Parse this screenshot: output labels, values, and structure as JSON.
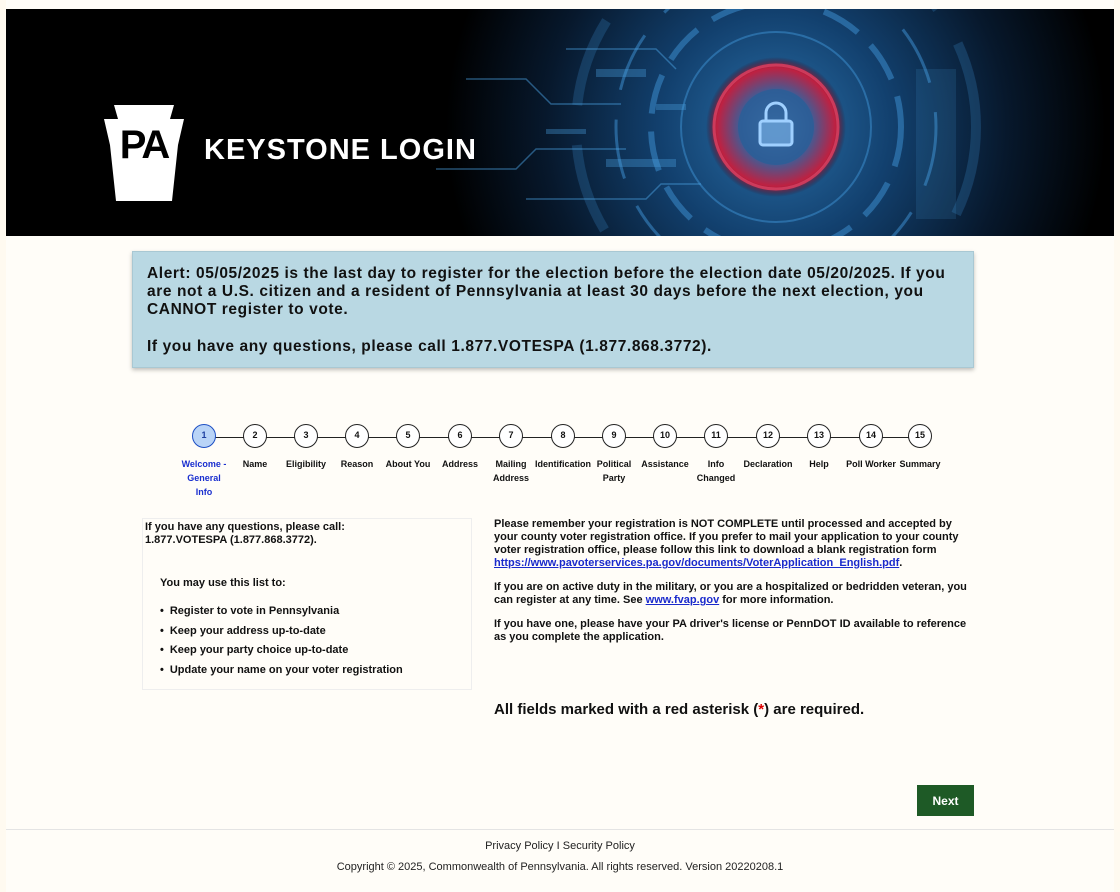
{
  "banner": {
    "logo_letters": "PA",
    "title": "KEYSTONE LOGIN"
  },
  "alert": {
    "message": "Alert: 05/05/2025 is the last day to register for the election before the election date 05/20/2025. If you are not a U.S. citizen and a resident of Pennsylvania at least 30 days before the next election, you CANNOT register to vote.",
    "questions": "If you have any questions, please call 1.877.VOTESPA (1.877.868.3772)."
  },
  "stepper": {
    "steps": [
      {
        "number": "1",
        "label": "Welcome - General Info"
      },
      {
        "number": "2",
        "label": "Name"
      },
      {
        "number": "3",
        "label": "Eligibility"
      },
      {
        "number": "4",
        "label": "Reason"
      },
      {
        "number": "5",
        "label": "About You"
      },
      {
        "number": "6",
        "label": "Address"
      },
      {
        "number": "7",
        "label": "Mailing Address"
      },
      {
        "number": "8",
        "label": "Identification"
      },
      {
        "number": "9",
        "label": "Political Party"
      },
      {
        "number": "10",
        "label": "Assistance"
      },
      {
        "number": "11",
        "label": "Info Changed"
      },
      {
        "number": "12",
        "label": "Declaration"
      },
      {
        "number": "13",
        "label": "Help"
      },
      {
        "number": "14",
        "label": "Poll Worker"
      },
      {
        "number": "15",
        "label": "Summary"
      }
    ]
  },
  "left_panel": {
    "call_text": "If you have any questions, please call: 1.877.VOTESPA (1.877.868.3772).",
    "use_list_heading": "You may use this list to:",
    "items": [
      "Register to vote in Pennsylvania",
      "Keep your address up-to-date",
      "Keep your party choice up-to-date",
      "Update your name on your voter registration"
    ]
  },
  "right_panel": {
    "reminder_text": "Please remember your registration is NOT COMPLETE until processed and accepted by your county voter registration office. If you prefer to mail your application to your county voter registration office, please follow this link to download a blank registration form",
    "form_link": "https://www.pavoterservices.pa.gov/documents/VoterApplication_English.pdf",
    "military_text_before": "If you are on active duty in the military, or you are a hospitalized or bedridden veteran, you can register at any time. See",
    "fvap_link": "www.fvap.gov",
    "military_text_after": "for more information.",
    "license_text": "If you have one, please have your PA driver's license or PennDOT ID available to reference as you complete the application.",
    "required_before": "All fields marked with a red asterisk (",
    "required_asterisk": "*",
    "required_after": ") are required."
  },
  "actions": {
    "next_label": "Next"
  },
  "footer": {
    "privacy_label": "Privacy Policy",
    "separator": "I",
    "security_label": "Security Policy",
    "copyright": "Copyright © 2025, Commonwealth of Pennsylvania. All rights reserved. Version 20220208.1"
  },
  "colors": {
    "alert_bg": "#b9d8e3",
    "active_step": "#1a2fcf",
    "next_button": "#1e5a26",
    "link": "#1a2acc",
    "asterisk": "#dd0000"
  }
}
